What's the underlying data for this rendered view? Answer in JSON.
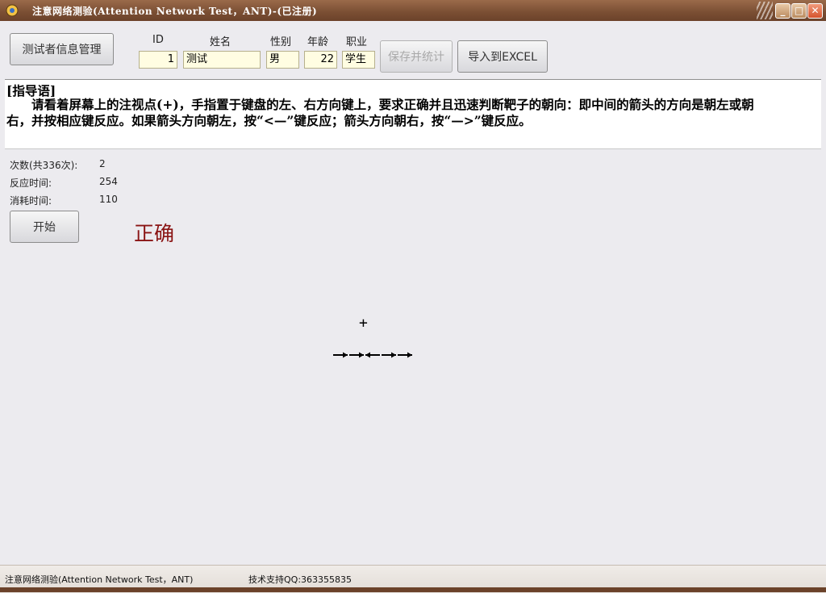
{
  "window": {
    "title": "注意网络测验(Attention Network Test，ANT)-(已注册)",
    "controls": {
      "minimize": "_",
      "maximize": "□",
      "close": "✕"
    }
  },
  "toolbar": {
    "manage_label": "测试者信息管理",
    "save_label": "保存并统计",
    "export_label": "导入到EXCEL"
  },
  "form": {
    "id_label": "ID",
    "id_value": "1",
    "name_label": "姓名",
    "name_value": "测试",
    "gender_label": "性别",
    "gender_value": "男",
    "age_label": "年龄",
    "age_value": "22",
    "job_label": "职业",
    "job_value": "学生"
  },
  "instructions": {
    "title": "[指导语]",
    "body": "请看着屏幕上的注视点(+)，手指置于键盘的左、右方向键上，要求正确并且迅速判断靶子的朝向：即中间的箭头的方向是朝左或朝右，并按相应键反应。如果箭头方向朝左，按“<—”键反应；箭头方向朝右，按“—>”键反应。"
  },
  "stats": {
    "trials_label": "次数(共336次):",
    "trials_value": "2",
    "rt_label": "反应时间:",
    "rt_value": "254",
    "elapsed_label": "消耗时间:",
    "elapsed_value": "110"
  },
  "start_label": "开始",
  "feedback": "正确",
  "stimulus": {
    "fixation": "+",
    "arrows": [
      "right",
      "right",
      "left",
      "right",
      "right"
    ]
  },
  "statusbar": {
    "left": "注意网络测验(Attention Network Test，ANT)",
    "right": "技术支持QQ:363355835"
  },
  "colors": {
    "titlebar": "#7a4e33",
    "feedback": "#8a1414",
    "field_bg": "#fffde2"
  }
}
